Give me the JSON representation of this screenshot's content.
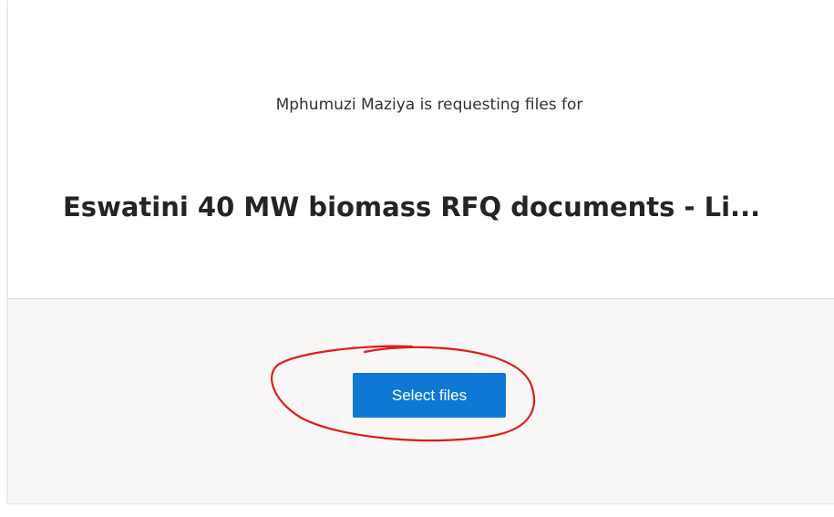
{
  "request": {
    "requester_line": "Mphumuzi Maziya is requesting files for",
    "title": "Eswatini 40 MW biomass RFQ documents - Li..."
  },
  "upload": {
    "select_label": "Select files",
    "button_color": "#0f78d4"
  },
  "annotation": {
    "shape": "hand-drawn ellipse",
    "color": "#e01b1b"
  }
}
